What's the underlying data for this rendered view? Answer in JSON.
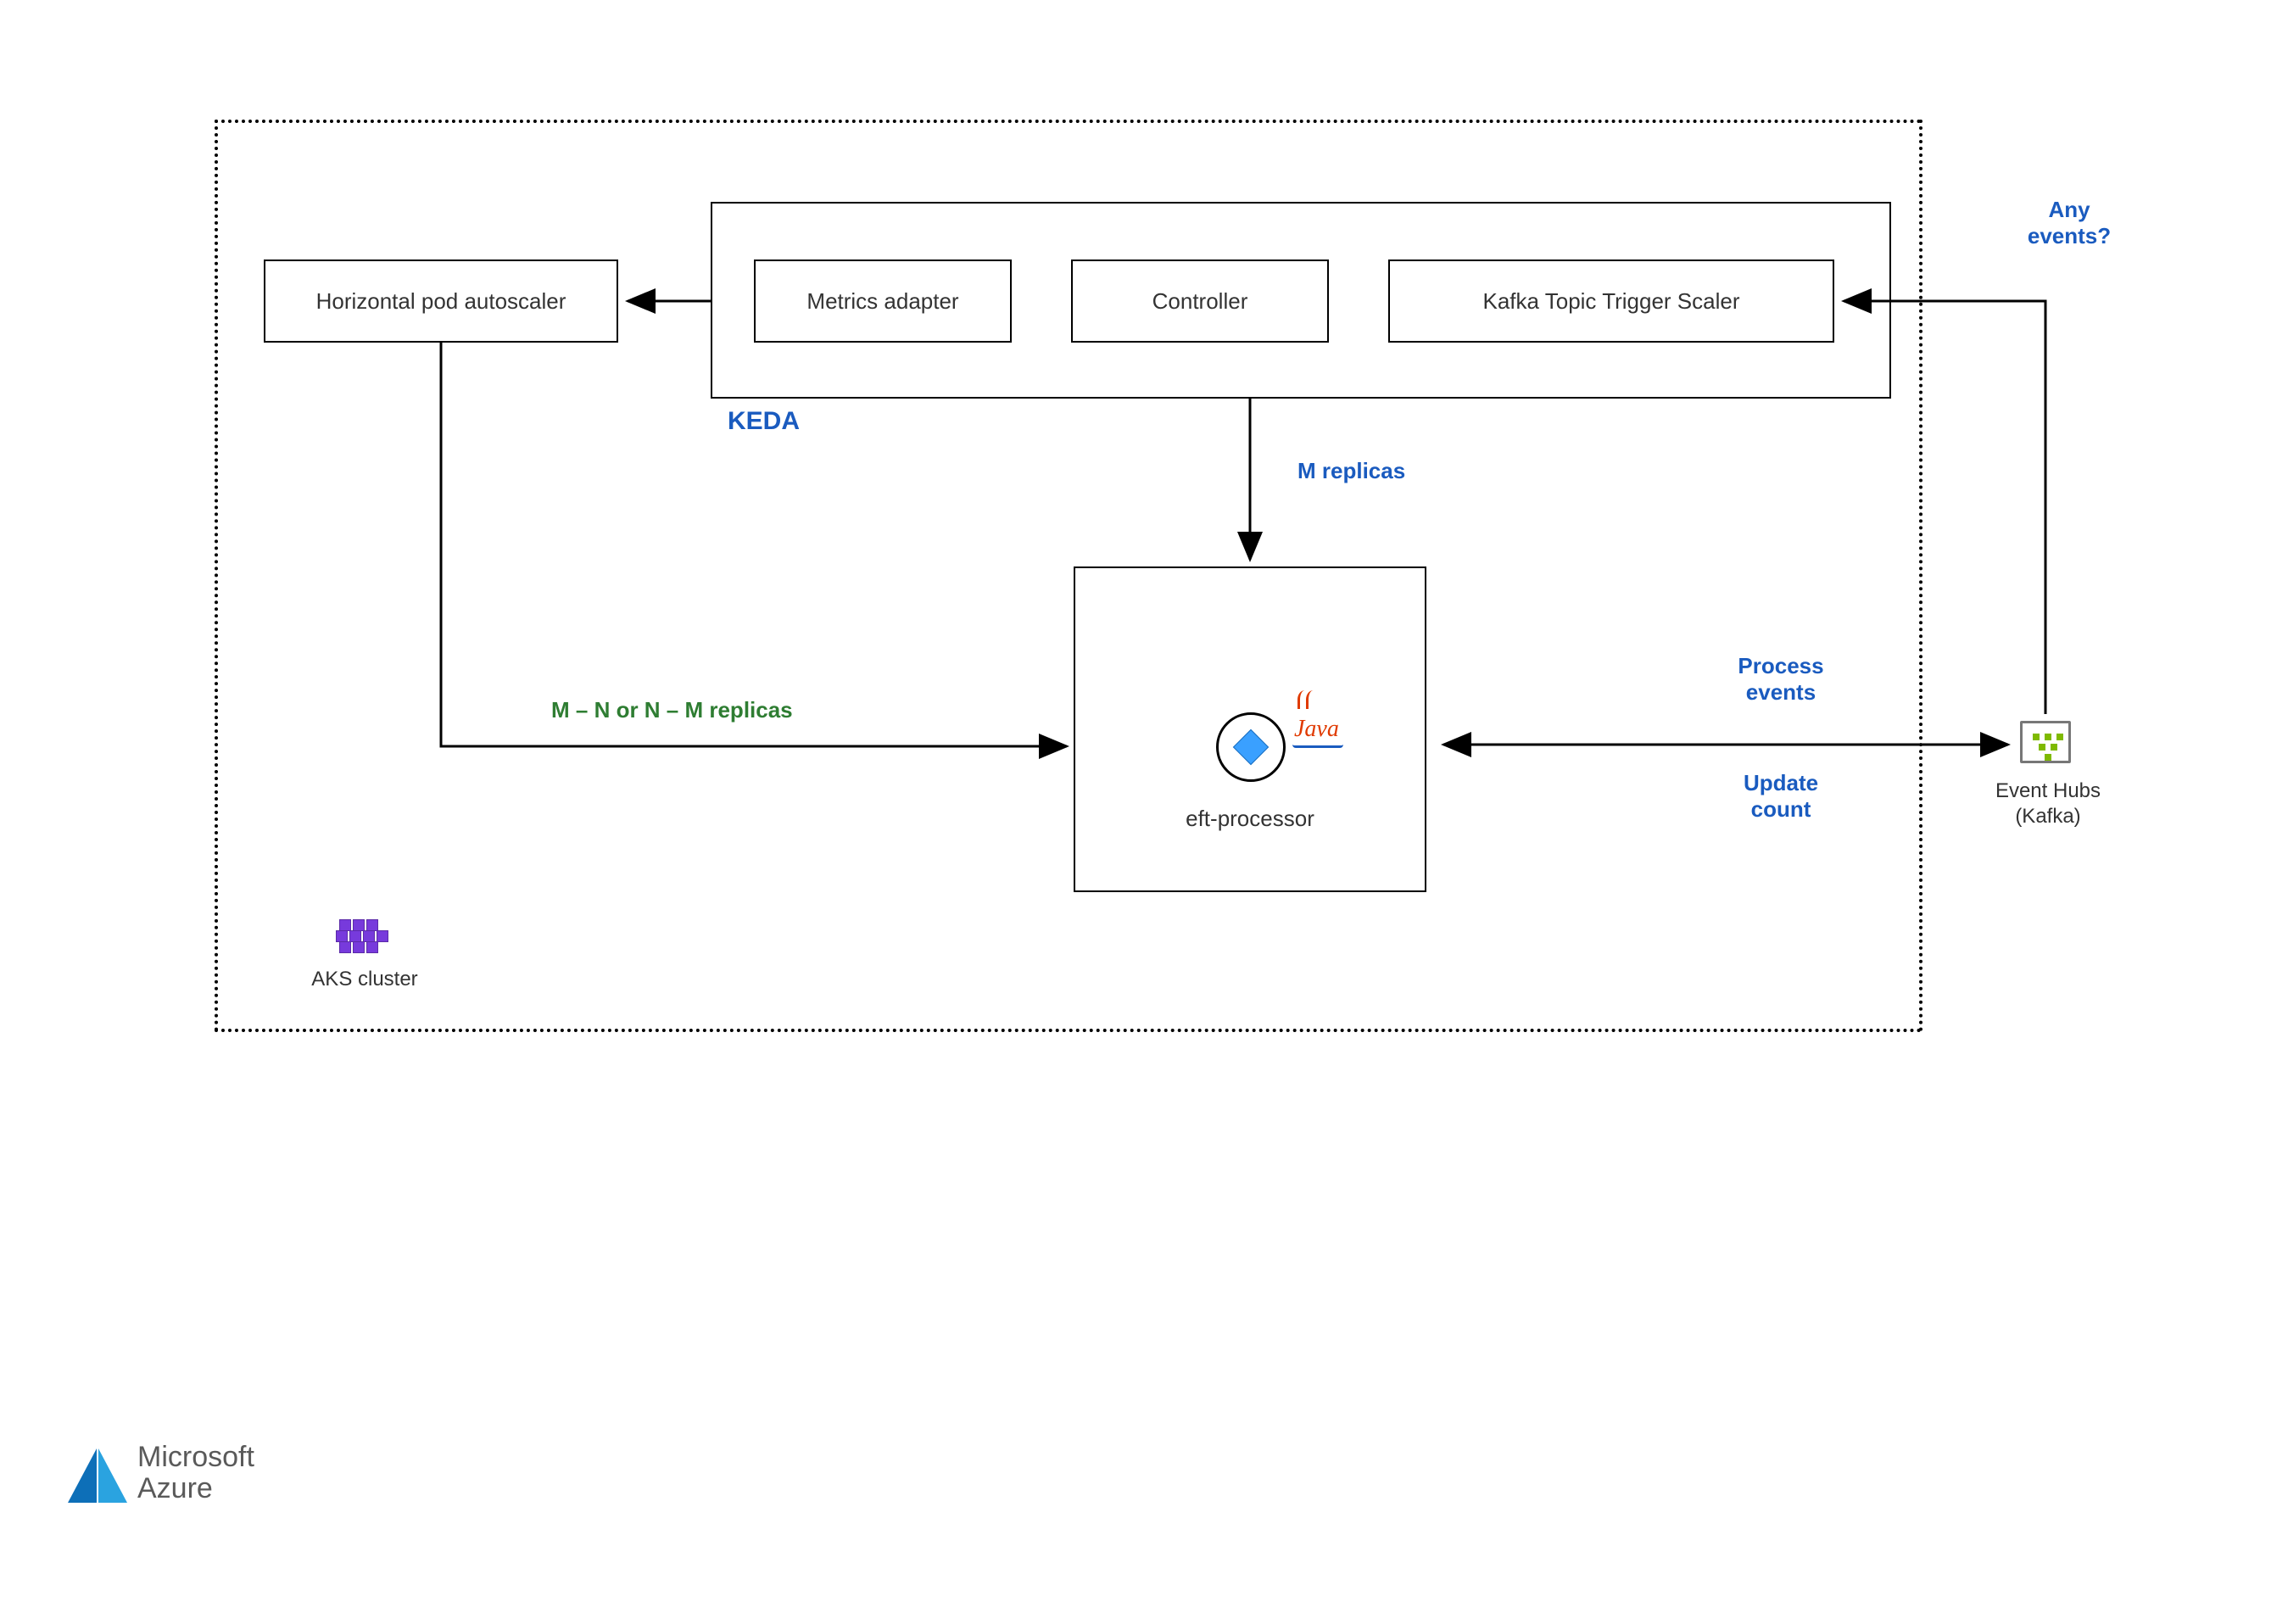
{
  "cluster": {
    "label": "AKS cluster"
  },
  "hpa": {
    "label": "Horizontal pod autoscaler"
  },
  "keda": {
    "label": "KEDA",
    "metrics_adapter": "Metrics adapter",
    "controller": "Controller",
    "kafka_trigger": "Kafka Topic Trigger Scaler"
  },
  "processor": {
    "label": "eft-processor",
    "tech_icon_name": "java-icon"
  },
  "eventhubs": {
    "label_line1": "Event Hubs",
    "label_line2": "(Kafka)"
  },
  "arrows": {
    "any_events": "Any\nevents?",
    "m_replicas": "M replicas",
    "hpa_replicas": "M – N or N – M replicas",
    "process_events": "Process\nevents",
    "update_count": "Update\ncount"
  },
  "footer": {
    "brand_line1": "Microsoft",
    "brand_line2": "Azure"
  },
  "colors": {
    "accent_blue": "#1a5bbf",
    "accent_green": "#2e7d32",
    "aks_purple": "#773adc",
    "eventhubs_green": "#7fba00"
  }
}
